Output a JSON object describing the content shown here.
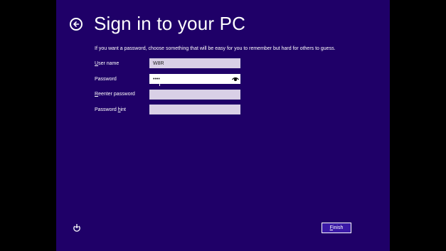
{
  "page": {
    "title": "Sign in to your PC",
    "instructions": "If you want a password, choose something that will be easy for you to remember but hard for others to guess."
  },
  "form": {
    "username": {
      "label_prefix": "",
      "label_access_key": "U",
      "label_rest": "ser name",
      "value": "W8R"
    },
    "password": {
      "label": "Password",
      "value": "••••"
    },
    "reenter": {
      "label_access_key": "R",
      "label_rest": "eenter password",
      "value": ""
    },
    "hint": {
      "label_prefix": "Password ",
      "label_access_key": "h",
      "label_rest": "int",
      "value": ""
    }
  },
  "footer": {
    "finish_prefix": "",
    "finish_access_key": "F",
    "finish_rest": "inish"
  },
  "icons": {
    "back": "back-arrow-circle-icon",
    "reveal": "eye-icon",
    "ease_of_access": "ease-of-access-icon"
  },
  "colors": {
    "background": "#1f0068",
    "input_fill": "#d9d0e6",
    "button_fill": "#3a18a6"
  }
}
